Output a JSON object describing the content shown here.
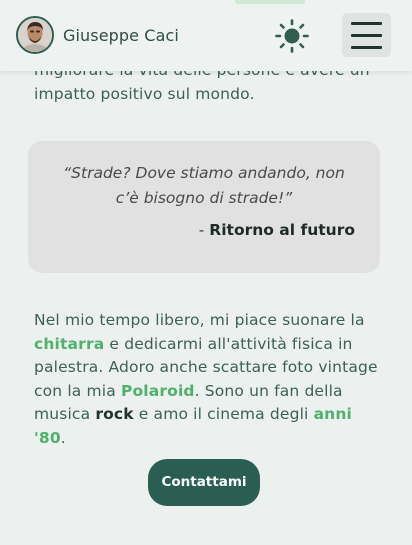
{
  "header": {
    "site_name": "Giuseppe Caci",
    "theme_icon": "sun-icon",
    "menu_icon": "hamburger-menu-icon"
  },
  "intro": {
    "text": "migliorare la vita delle persone e avere un impatto positivo sul mondo."
  },
  "quote": {
    "text": "“Strade? Dove stiamo andando, non c’è bisogno di strade!”",
    "dash": "- ",
    "source": "Ritorno al futuro"
  },
  "hobbies": {
    "p1": "Nel mio tempo libero, mi piace suonare la ",
    "h1": "chitarra",
    "p2": " e dedicarmi all'attività fisica in palestra. Adoro anche scattare foto vintage con la mia ",
    "h2": "Polaroid",
    "p3": ". Sono un fan della musica ",
    "h3": "rock",
    "p4": " e amo il cinema degli ",
    "h4": "anni '80",
    "p5": "."
  },
  "contact_button": {
    "label": "Contattami"
  },
  "colors": {
    "accent_green": "#4fb16a",
    "button_dark_green": "#2b5e52",
    "background": "#ecf1ef",
    "quote_card": "#e1e1e1"
  }
}
